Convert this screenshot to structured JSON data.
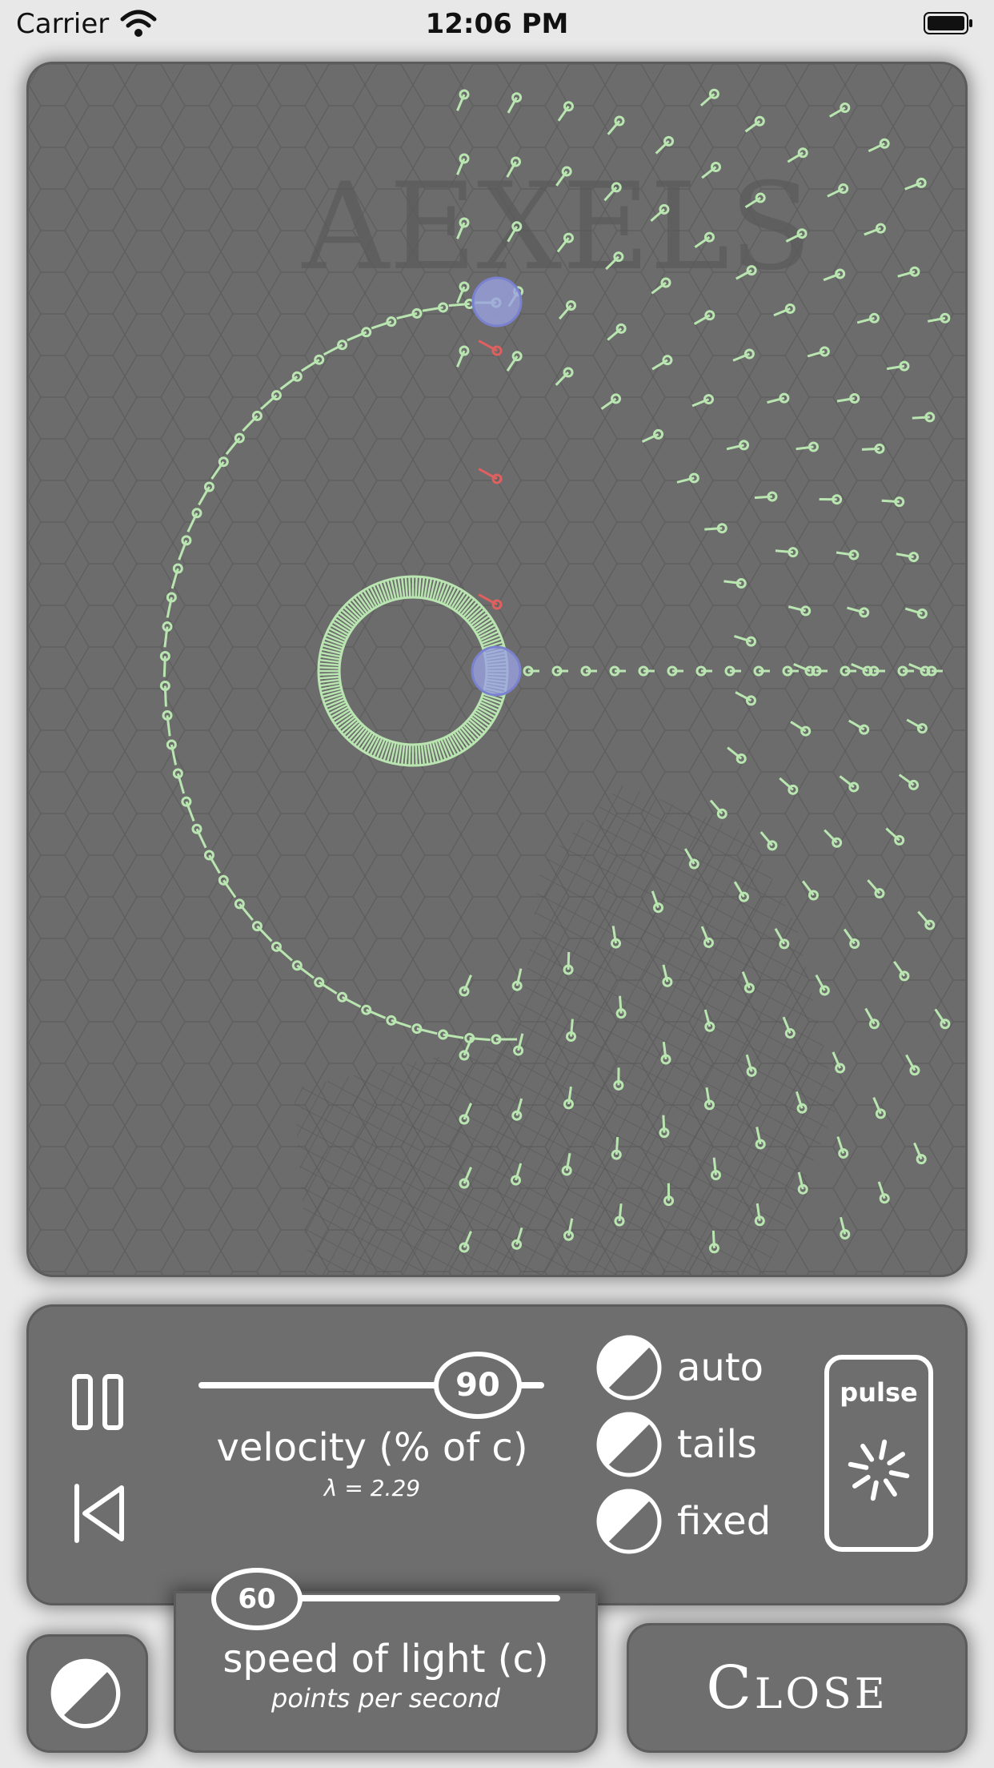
{
  "status_bar": {
    "carrier": "Carrier",
    "time": "12:06 PM"
  },
  "simulation": {
    "watermark": "AEXELS",
    "colors": {
      "background": "#6c6c6c",
      "aexel": "#b9e6b0",
      "highlight": "#e06060",
      "emitter": "#9aa2e0"
    }
  },
  "controls": {
    "pause_icon": "pause-icon",
    "reset_icon": "skip-back-icon",
    "velocity": {
      "value": "90",
      "label": "velocity (% of c)",
      "lambda": "λ = 2.29"
    },
    "toggles": [
      {
        "label": "auto",
        "icon": "half-circle-icon"
      },
      {
        "label": "tails",
        "icon": "half-circle-icon"
      },
      {
        "label": "fixed",
        "icon": "half-circle-icon"
      }
    ],
    "pulse": {
      "label": "pulse",
      "icon": "burst-icon"
    }
  },
  "speed_of_light": {
    "value": "60",
    "label": "speed of light (c)",
    "sublabel": "points per second"
  },
  "theme_button": {
    "icon": "half-circle-icon"
  },
  "close_button": {
    "label": "Close"
  }
}
